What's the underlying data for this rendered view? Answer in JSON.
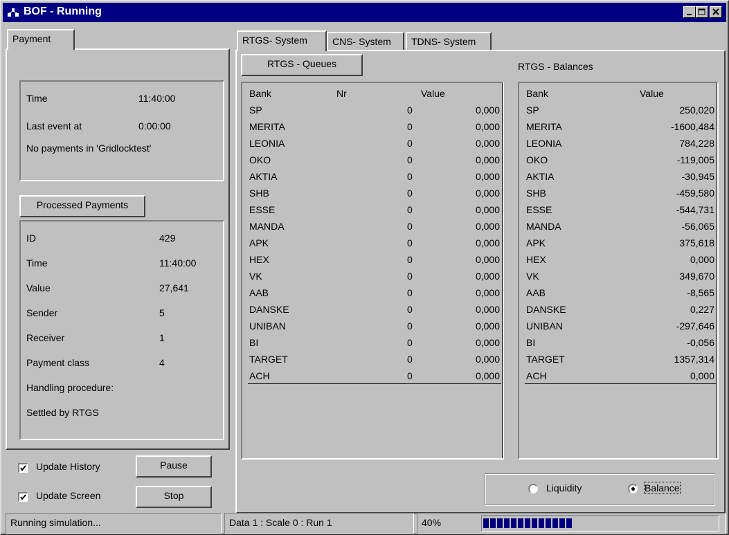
{
  "window": {
    "title": "BOF - Running"
  },
  "left": {
    "tab": "Payment",
    "event": {
      "time_label": "Time",
      "time_value": "11:40:00",
      "last_label": "Last event at",
      "last_value": "0:00:00",
      "message": "No payments in 'Gridlocktest'"
    },
    "processed_button": "Processed Payments",
    "processed": {
      "id_label": "ID",
      "id_value": "429",
      "time_label": "Time",
      "time_value": "11:40:00",
      "value_label": "Value",
      "value_value": "27,641",
      "sender_label": "Sender",
      "sender_value": "5",
      "receiver_label": "Receiver",
      "receiver_value": "1",
      "class_label": "Payment class",
      "class_value": "4",
      "handling_label": "Handling procedure:",
      "settled_label": "Settled by RTGS"
    },
    "update_history": {
      "label": "Update History",
      "checked": true
    },
    "update_screen": {
      "label": "Update Screen",
      "checked": true
    },
    "pause_button": "Pause",
    "stop_button": "Stop"
  },
  "right": {
    "tabs": [
      "RTGS- System",
      "CNS- System",
      "TDNS- System"
    ],
    "queues_button": "RTGS - Queues",
    "balances_title": "RTGS - Balances",
    "queues_headers": {
      "bank": "Bank",
      "nr": "Nr",
      "value": "Value"
    },
    "balances_headers": {
      "bank": "Bank",
      "value": "Value"
    },
    "queues": [
      {
        "bank": "SP",
        "nr": "0",
        "value": "0,000"
      },
      {
        "bank": "MERITA",
        "nr": "0",
        "value": "0,000"
      },
      {
        "bank": "LEONIA",
        "nr": "0",
        "value": "0,000"
      },
      {
        "bank": "OKO",
        "nr": "0",
        "value": "0,000"
      },
      {
        "bank": "AKTIA",
        "nr": "0",
        "value": "0,000"
      },
      {
        "bank": "SHB",
        "nr": "0",
        "value": "0,000"
      },
      {
        "bank": "ESSE",
        "nr": "0",
        "value": "0,000"
      },
      {
        "bank": "MANDA",
        "nr": "0",
        "value": "0,000"
      },
      {
        "bank": "APK",
        "nr": "0",
        "value": "0,000"
      },
      {
        "bank": "HEX",
        "nr": "0",
        "value": "0,000"
      },
      {
        "bank": "VK",
        "nr": "0",
        "value": "0,000"
      },
      {
        "bank": "AAB",
        "nr": "0",
        "value": "0,000"
      },
      {
        "bank": "DANSKE",
        "nr": "0",
        "value": "0,000"
      },
      {
        "bank": "UNIBAN",
        "nr": "0",
        "value": "0,000"
      },
      {
        "bank": "BI",
        "nr": "0",
        "value": "0,000"
      },
      {
        "bank": "TARGET",
        "nr": "0",
        "value": "0,000"
      },
      {
        "bank": "ACH",
        "nr": "0",
        "value": "0,000"
      }
    ],
    "balances": [
      {
        "bank": "SP",
        "value": "250,020"
      },
      {
        "bank": "MERITA",
        "value": "-1600,484"
      },
      {
        "bank": "LEONIA",
        "value": "784,228"
      },
      {
        "bank": "OKO",
        "value": "-119,005"
      },
      {
        "bank": "AKTIA",
        "value": "-30,945"
      },
      {
        "bank": "SHB",
        "value": "-459,580"
      },
      {
        "bank": "ESSE",
        "value": "-544,731"
      },
      {
        "bank": "MANDA",
        "value": "-56,065"
      },
      {
        "bank": "APK",
        "value": "375,618"
      },
      {
        "bank": "HEX",
        "value": "0,000"
      },
      {
        "bank": "VK",
        "value": "349,670"
      },
      {
        "bank": "AAB",
        "value": "-8,565"
      },
      {
        "bank": "DANSKE",
        "value": "0,227"
      },
      {
        "bank": "UNIBAN",
        "value": "-297,646"
      },
      {
        "bank": "BI",
        "value": "-0,056"
      },
      {
        "bank": "TARGET",
        "value": "1357,314"
      },
      {
        "bank": "ACH",
        "value": "0,000"
      }
    ],
    "radio_liquidity": {
      "label": "Liquidity",
      "selected": false
    },
    "radio_balance": {
      "label": "Balance",
      "selected": true
    }
  },
  "status": {
    "message": "Running simulation...",
    "data": "Data 1 : Scale 0 : Run 1",
    "percent": "40%",
    "progress_fraction": 0.4
  },
  "colors": {
    "title_bg": "#000080",
    "face": "#c0c0c0",
    "progress": "#000080"
  }
}
